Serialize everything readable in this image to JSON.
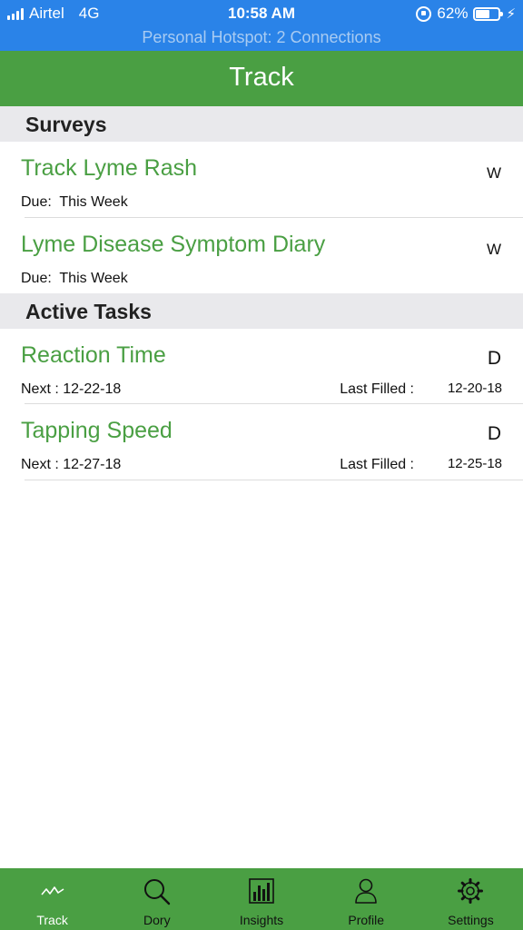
{
  "status_bar": {
    "carrier": "Airtel",
    "network": "4G",
    "time": "10:58 AM",
    "battery_percent": "62%",
    "battery_level": 0.62,
    "hotspot": "Personal Hotspot: 2 Connections"
  },
  "nav": {
    "title": "Track"
  },
  "surveys": {
    "header": "Surveys",
    "items": [
      {
        "title": "Track Lyme Rash",
        "frequency": "W",
        "due_label": "Due:",
        "due_value": "This Week"
      },
      {
        "title": "Lyme Disease Symptom Diary",
        "frequency": "W",
        "due_label": "Due:",
        "due_value": "This Week"
      }
    ]
  },
  "active_tasks": {
    "header": "Active Tasks",
    "items": [
      {
        "title": "Reaction Time",
        "frequency": "D",
        "next": "Next : 12-22-18",
        "last_label": "Last Filled :",
        "last_value": "12-20-18"
      },
      {
        "title": "Tapping Speed",
        "frequency": "D",
        "next": "Next : 12-27-18",
        "last_label": "Last Filled :",
        "last_value": "12-25-18"
      }
    ]
  },
  "tabs": [
    {
      "label": "Track",
      "icon": "activity-icon",
      "active": true
    },
    {
      "label": "Dory",
      "icon": "search-icon"
    },
    {
      "label": "Insights",
      "icon": "bar-chart-icon"
    },
    {
      "label": "Profile",
      "icon": "person-icon"
    },
    {
      "label": "Settings",
      "icon": "gear-icon"
    }
  ],
  "colors": {
    "status_bar": "#2a83e8",
    "brand_green": "#4a9f43",
    "section_header_bg": "#e9e9ec"
  }
}
